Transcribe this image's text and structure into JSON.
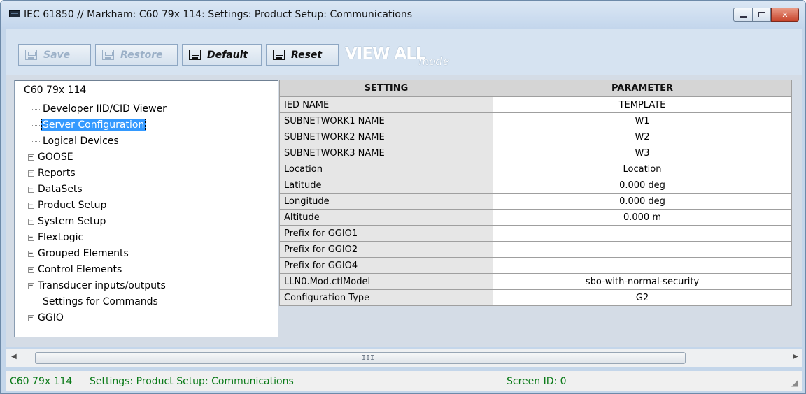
{
  "window": {
    "title": "IEC 61850 // Markham: C60 79x 114: Settings: Product Setup: Communications",
    "controls": {
      "minimize": "minimize",
      "maximize": "maximize",
      "close": "✕"
    }
  },
  "toolbar": {
    "save_label": "Save",
    "restore_label": "Restore",
    "default_label": "Default",
    "reset_label": "Reset",
    "view_all_label": "VIEW ALL",
    "view_mode_label": "mode"
  },
  "tree": {
    "root": "C60 79x 114",
    "items": [
      {
        "label": "Developer IID/CID Viewer",
        "expandable": false,
        "selected": false
      },
      {
        "label": "Server Configuration",
        "expandable": false,
        "selected": true
      },
      {
        "label": "Logical Devices",
        "expandable": false,
        "selected": false
      },
      {
        "label": "GOOSE",
        "expandable": true,
        "selected": false
      },
      {
        "label": "Reports",
        "expandable": true,
        "selected": false
      },
      {
        "label": "DataSets",
        "expandable": true,
        "selected": false
      },
      {
        "label": "Product Setup",
        "expandable": true,
        "selected": false
      },
      {
        "label": "System Setup",
        "expandable": true,
        "selected": false
      },
      {
        "label": "FlexLogic",
        "expandable": true,
        "selected": false
      },
      {
        "label": "Grouped Elements",
        "expandable": true,
        "selected": false
      },
      {
        "label": "Control Elements",
        "expandable": true,
        "selected": false
      },
      {
        "label": "Transducer inputs/outputs",
        "expandable": true,
        "selected": false
      },
      {
        "label": "Settings for Commands",
        "expandable": false,
        "selected": false
      },
      {
        "label": "GGIO",
        "expandable": true,
        "selected": false
      }
    ]
  },
  "table": {
    "headers": [
      "SETTING",
      "PARAMETER"
    ],
    "rows": [
      {
        "setting": "IED NAME",
        "parameter": "TEMPLATE"
      },
      {
        "setting": "SUBNETWORK1 NAME",
        "parameter": "W1"
      },
      {
        "setting": "SUBNETWORK2 NAME",
        "parameter": "W2"
      },
      {
        "setting": "SUBNETWORK3 NAME",
        "parameter": "W3"
      },
      {
        "setting": "Location",
        "parameter": "Location"
      },
      {
        "setting": "Latitude",
        "parameter": "0.000 deg"
      },
      {
        "setting": "Longitude",
        "parameter": "0.000 deg"
      },
      {
        "setting": "Altitude",
        "parameter": "0.000 m"
      },
      {
        "setting": "Prefix for GGIO1",
        "parameter": ""
      },
      {
        "setting": "Prefix for GGIO2",
        "parameter": ""
      },
      {
        "setting": "Prefix for GGIO4",
        "parameter": ""
      },
      {
        "setting": "LLN0.Mod.ctlModel",
        "parameter": "sbo-with-normal-security"
      },
      {
        "setting": "Configuration Type",
        "parameter": "G2"
      }
    ]
  },
  "scrollbar": {
    "grip": "III"
  },
  "status": {
    "device": "C60 79x 114",
    "path": "Settings: Product Setup: Communications",
    "screen_id": "Screen ID: 0"
  }
}
